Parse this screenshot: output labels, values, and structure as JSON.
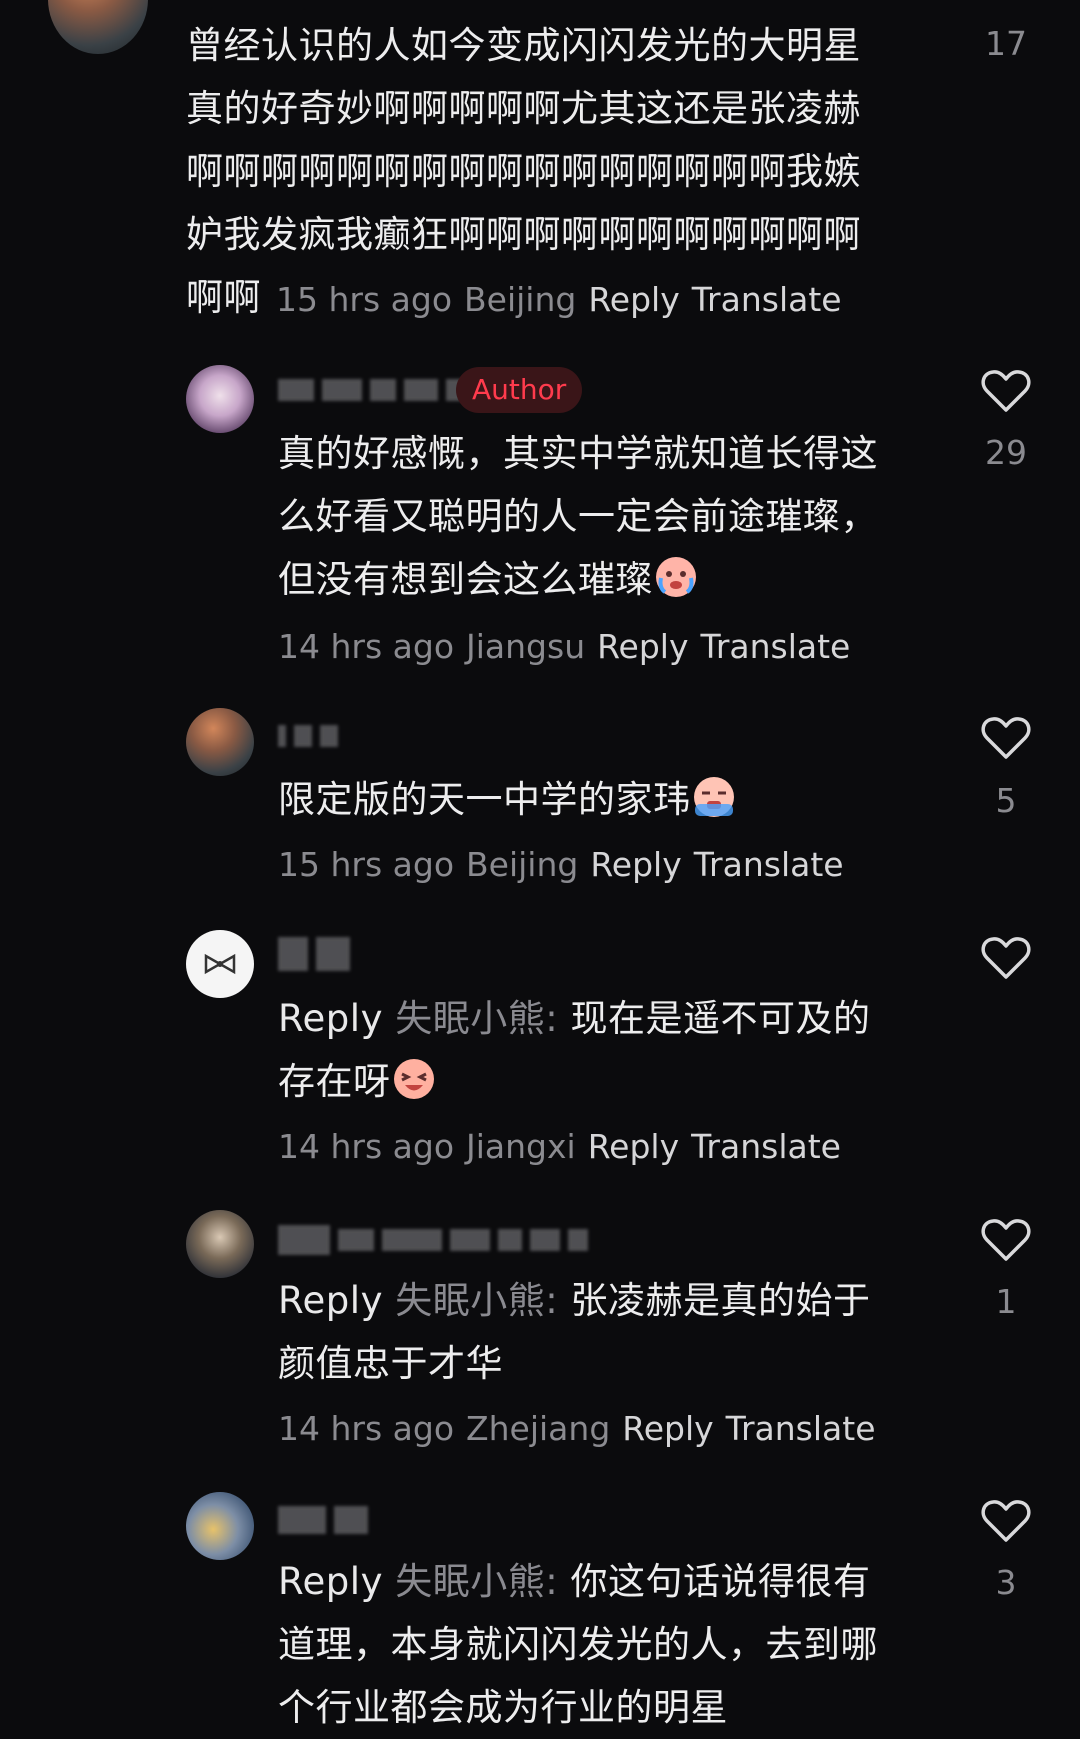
{
  "comments": [
    {
      "id": "c0",
      "text_lines": [
        "曾经认识的人如今变成闪闪发光的大明星",
        "真的好奇妙啊啊啊啊啊尤其这还是张凌赫",
        "啊啊啊啊啊啊啊啊啊啊啊啊啊啊啊啊我嫉",
        "妒我发疯我癫狂啊啊啊啊啊啊啊啊啊啊啊"
      ],
      "last_line_text": "啊啊",
      "time": "15 hrs ago",
      "location": "Beijing",
      "reply_label": "Reply",
      "translate_label": "Translate",
      "likes": "17"
    },
    {
      "id": "c1",
      "badge": "Author",
      "text_lines": [
        "真的好感慨，其实中学就知道长得这",
        "么好看又聪明的人一定会前途璀璨，",
        "但没有想到会这么璀璨"
      ],
      "time": "14 hrs ago",
      "location": "Jiangsu",
      "reply_label": "Reply",
      "translate_label": "Translate",
      "likes": "29",
      "emoji": "crying-face"
    },
    {
      "id": "c2",
      "text_lines": [
        "限定版的天一中学的家玮"
      ],
      "time": "15 hrs ago",
      "location": "Beijing",
      "reply_label": "Reply",
      "translate_label": "Translate",
      "likes": "5",
      "emoji": "sobbing-face"
    },
    {
      "id": "c3",
      "reply_prefix": "Reply",
      "reply_target": "失眠小熊:",
      "text_lines": [
        "现在是遥不可及的",
        "存在呀"
      ],
      "time": "14 hrs ago",
      "location": "Jiangxi",
      "reply_label": "Reply",
      "translate_label": "Translate",
      "likes": "",
      "emoji": "laughing-face"
    },
    {
      "id": "c4",
      "reply_prefix": "Reply",
      "reply_target": "失眠小熊:",
      "text_lines": [
        "张凌赫是真的始于",
        "颜值忠于才华"
      ],
      "time": "14 hrs ago",
      "location": "Zhejiang",
      "reply_label": "Reply",
      "translate_label": "Translate",
      "likes": "1"
    },
    {
      "id": "c5",
      "reply_prefix": "Reply",
      "reply_target": "失眠小熊:",
      "text_lines": [
        "你这句话说得很有",
        "道理，本身就闪闪发光的人，去到哪",
        "个行业都会成为行业的明星"
      ],
      "likes": "3"
    }
  ],
  "icons": {
    "heart": "heart-outline-icon"
  },
  "colors": {
    "background": "#0b0b0d",
    "author_badge": "#ff3b4d",
    "muted_text": "#8b8b90"
  }
}
